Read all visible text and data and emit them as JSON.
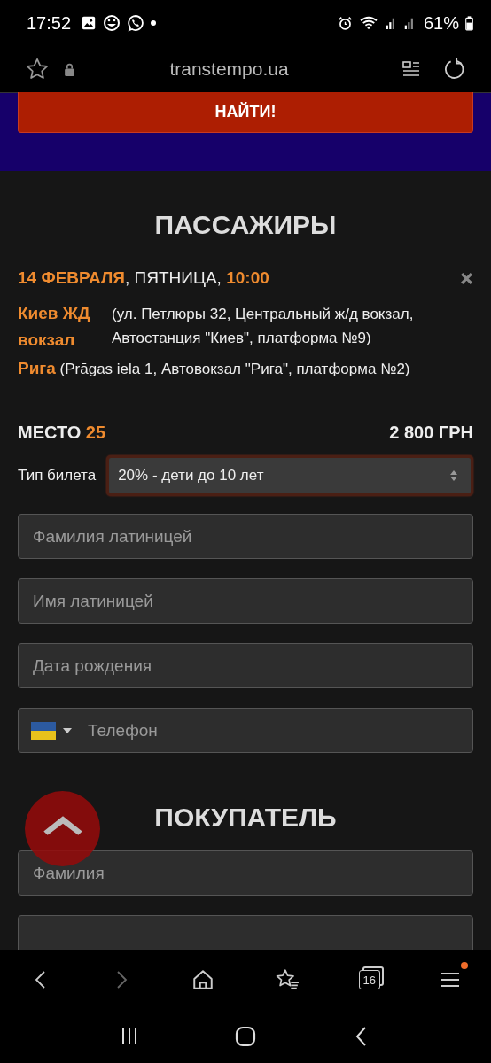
{
  "status_bar": {
    "time": "17:52",
    "battery": "61%"
  },
  "browser": {
    "url": "transtempo.ua",
    "tab_count": "16",
    "menu_badge": true
  },
  "search_button": "НАЙТИ!",
  "passengers": {
    "title": "ПАССАЖИРЫ",
    "trip_line": [
      {
        "text": "14 ФЕВРАЛЯ",
        "accent": true
      },
      {
        "text": ", ПЯТНИЦА, ",
        "accent": false
      },
      {
        "text": "10:00",
        "accent": true
      }
    ],
    "from": {
      "city": "Киев ЖД вокзал",
      "address": "(ул. Петлюры 32, Центральный ж/д вокзал, Автостанция \"Киев\", платформа №9)"
    },
    "to": {
      "city": "Рига",
      "address": "(Prāgas iela 1, Автовокзал \"Рига\", платформа №2)"
    },
    "seat": [
      {
        "text": "МЕСТО ",
        "accent": false
      },
      {
        "text": "25",
        "accent": true
      }
    ],
    "price": "2 800 ГРН",
    "ticket_type": {
      "label": "Тип билета",
      "value": "20% - дети до 10 лет"
    },
    "fields": [
      {
        "kind": "text",
        "placeholder": "Фамилия латиницей"
      },
      {
        "kind": "text",
        "placeholder": "Имя латиницей"
      },
      {
        "kind": "text",
        "placeholder": "Дата рождения"
      },
      {
        "kind": "phone",
        "placeholder": "Телефон"
      }
    ]
  },
  "buyer": {
    "title": "ПОКУПАТЕЛЬ",
    "fields": [
      {
        "kind": "text",
        "placeholder": "Фамилия"
      },
      {
        "kind": "text"
      }
    ]
  }
}
